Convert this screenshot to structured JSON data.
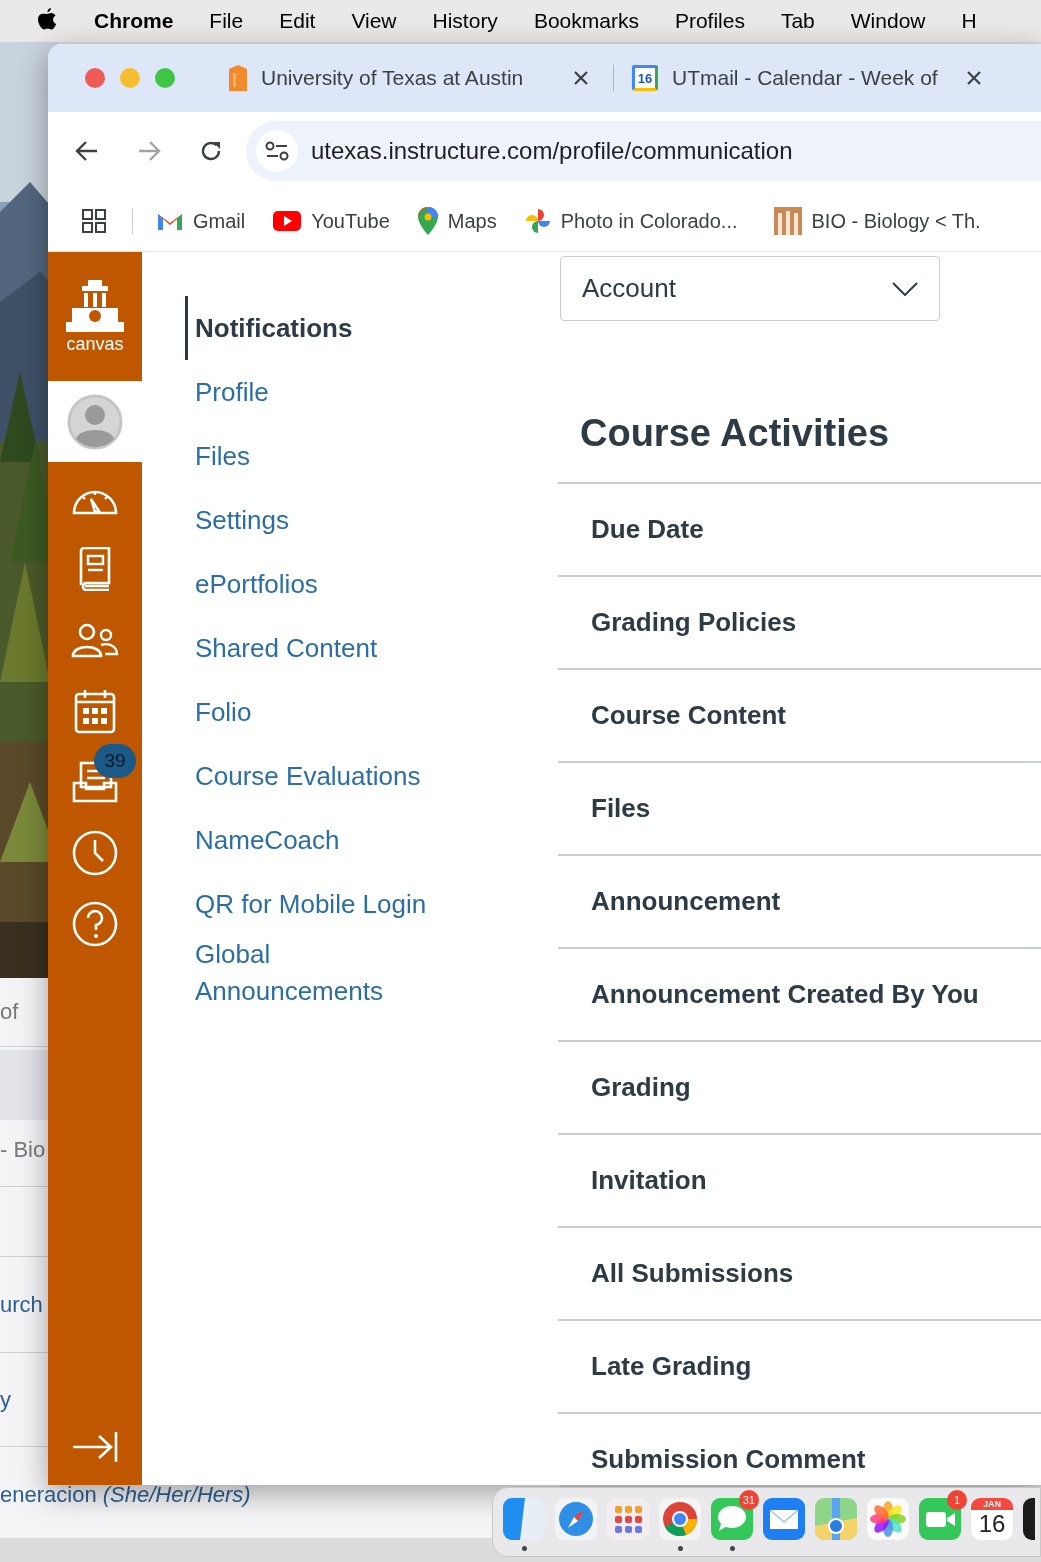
{
  "menu_bar": {
    "app_name": "Chrome",
    "menus": [
      "File",
      "Edit",
      "View",
      "History",
      "Bookmarks",
      "Profiles",
      "Tab",
      "Window",
      "H"
    ]
  },
  "background_window": {
    "texts": [
      {
        "text": "of",
        "kind": "muted"
      },
      {
        "text": "- Bio",
        "kind": "muted"
      },
      {
        "text": "urch",
        "kind": "link"
      },
      {
        "text": "y",
        "kind": "link"
      },
      {
        "text": "eneracion *(She/Her/Hers)*",
        "kind": "link"
      }
    ]
  },
  "browser": {
    "tabs": [
      {
        "title": "University of Texas at Austin",
        "kind": "bookmark"
      },
      {
        "title": "UTmail - Calendar - Week of",
        "kind": "calendar",
        "icon_text": "16"
      }
    ],
    "url": "utexas.instructure.com/profile/communication",
    "bookmarks": [
      {
        "label": "Gmail",
        "kind": "gmail"
      },
      {
        "label": "YouTube",
        "kind": "youtube"
      },
      {
        "label": "Maps",
        "kind": "maps"
      },
      {
        "label": "Photo in Colorado...",
        "kind": "pinwheel"
      },
      {
        "label": "BIO - Biology < Th.",
        "kind": "building"
      }
    ]
  },
  "global_nav": {
    "logo_label": "canvas",
    "items": [
      {
        "kind": "account",
        "selected": true
      },
      {
        "kind": "dashboard",
        "selected": false
      },
      {
        "kind": "courses",
        "selected": false
      },
      {
        "kind": "groups",
        "selected": false
      },
      {
        "kind": "calendar",
        "selected": false
      },
      {
        "kind": "inbox",
        "selected": false,
        "badge": "39"
      },
      {
        "kind": "history",
        "selected": false
      },
      {
        "kind": "help",
        "selected": false
      }
    ]
  },
  "profile_nav": {
    "items": [
      {
        "label": "Notifications",
        "selected": true
      },
      {
        "label": "Profile",
        "selected": false
      },
      {
        "label": "Files",
        "selected": false
      },
      {
        "label": "Settings",
        "selected": false
      },
      {
        "label": "ePortfolios",
        "selected": false
      },
      {
        "label": "Shared Content",
        "selected": false
      },
      {
        "label": "Folio",
        "selected": false
      },
      {
        "label": "Course Evaluations",
        "selected": false
      },
      {
        "label": "NameCoach",
        "selected": false
      },
      {
        "label": "QR for Mobile Login",
        "selected": false
      },
      {
        "label": "Global Announcements",
        "selected": false
      }
    ]
  },
  "main": {
    "context_select": {
      "value": "Account"
    },
    "heading": "Course Activities",
    "rows": [
      "Due Date",
      "Grading Policies",
      "Course Content",
      "Files",
      "Announcement",
      "Announcement Created By You",
      "Grading",
      "Invitation",
      "All Submissions",
      "Late Grading",
      "Submission Comment"
    ]
  },
  "dock": {
    "items": [
      {
        "kind": "finder",
        "running": true
      },
      {
        "kind": "safari",
        "running": false
      },
      {
        "kind": "launchpad",
        "running": false
      },
      {
        "kind": "chrome",
        "running": true
      },
      {
        "kind": "messages",
        "running": true,
        "badge": "31"
      },
      {
        "kind": "mail",
        "running": false
      },
      {
        "kind": "maps",
        "running": false
      },
      {
        "kind": "photos",
        "running": false
      },
      {
        "kind": "facetime",
        "running": false,
        "badge": "1"
      },
      {
        "kind": "calendar",
        "running": false,
        "month": "JAN",
        "day": "16"
      },
      {
        "kind": "dark",
        "running": false
      }
    ]
  }
}
